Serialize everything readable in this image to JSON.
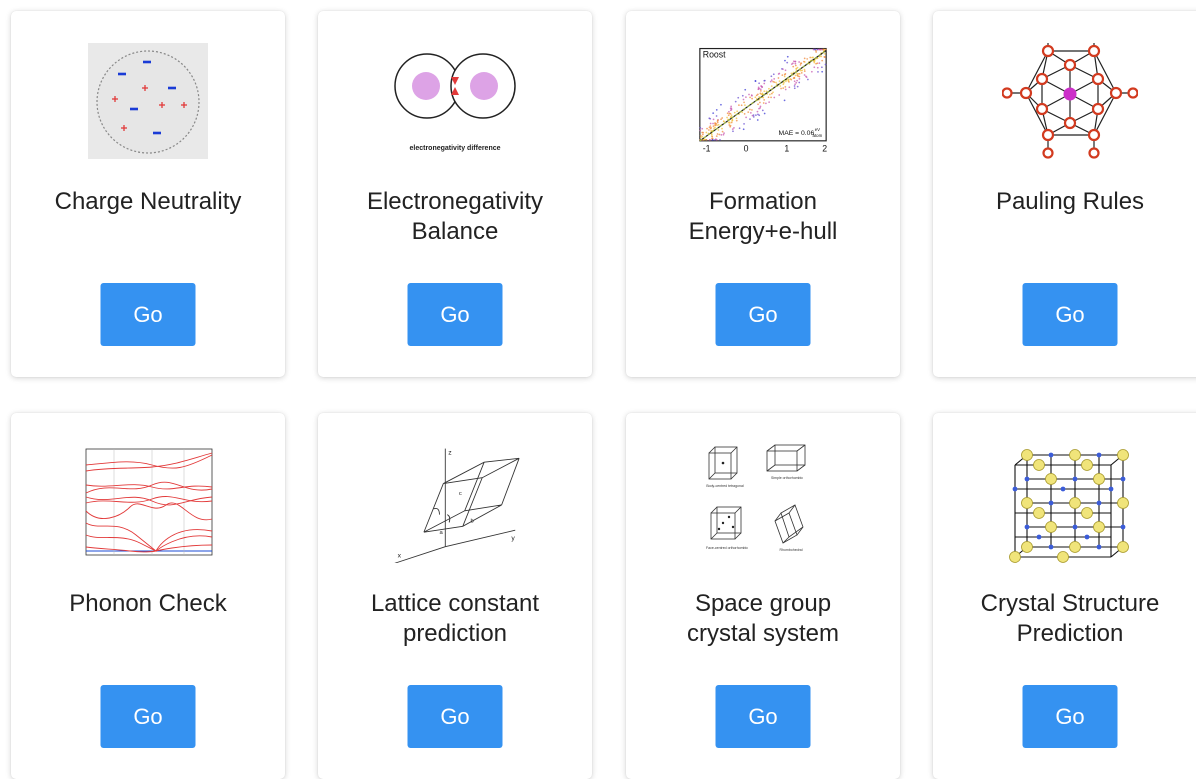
{
  "colors": {
    "button_bg": "#3592f1",
    "button_text": "#ffffff",
    "card_bg": "#ffffff",
    "title_text": "#222222"
  },
  "cards": [
    {
      "title": "Charge Neutrality",
      "button": "Go",
      "icon": "charge-neutrality-icon"
    },
    {
      "title": "Electronegativity\nBalance",
      "button": "Go",
      "icon": "electronegativity-icon",
      "caption": "electronegativity difference"
    },
    {
      "title": "Formation\nEnergy+e-hull",
      "button": "Go",
      "icon": "formation-energy-plot-icon",
      "plot_label": "Roost",
      "plot_mae": "MAE = 0.06",
      "plot_unit_top": "eV",
      "plot_unit_bottom": "atom",
      "plot_ticks": [
        "-1",
        "0",
        "1",
        "2"
      ]
    },
    {
      "title": "Pauling Rules",
      "button": "Go",
      "icon": "pauling-polyhedron-icon"
    },
    {
      "title": "Phonon Check",
      "button": "Go",
      "icon": "phonon-dispersion-icon"
    },
    {
      "title": "Lattice constant\nprediction",
      "button": "Go",
      "icon": "lattice-cell-icon",
      "axis_labels": [
        "z",
        "y",
        "x",
        "a",
        "b",
        "c"
      ]
    },
    {
      "title": "Space group\ncrystal system",
      "button": "Go",
      "icon": "crystal-systems-icon",
      "captions": [
        "Body-centred tetragonal",
        "Simple orthorhombic",
        "Face-centred orthorhombic",
        "Rhombohedral"
      ]
    },
    {
      "title": "Crystal Structure\nPrediction",
      "button": "Go",
      "icon": "crystal-structure-icon"
    }
  ]
}
